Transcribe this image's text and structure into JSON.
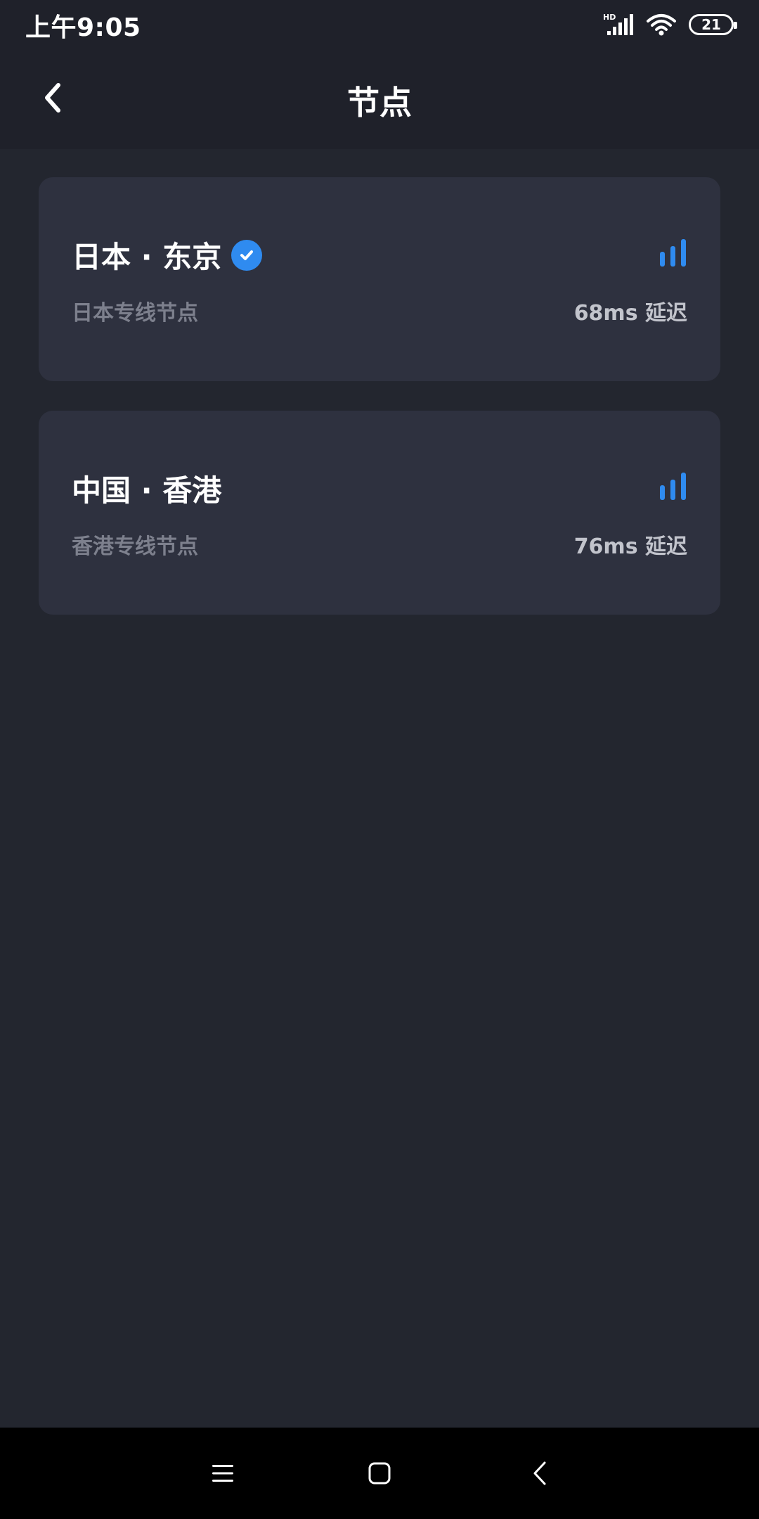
{
  "status_bar": {
    "time": "上午9:05",
    "network_label": "HD",
    "battery_level": "21"
  },
  "header": {
    "title": "节点"
  },
  "nodes": [
    {
      "name": "日本 · 东京",
      "description": "日本专线节点",
      "latency": "68ms 延迟",
      "selected": true
    },
    {
      "name": "中国 · 香港",
      "description": "香港专线节点",
      "latency": "76ms 延迟",
      "selected": false
    }
  ],
  "colors": {
    "background": "#23262f",
    "header_background": "#1f212a",
    "card_background": "#2e313f",
    "accent": "#2f8bf0",
    "muted_text": "#7d808d",
    "latency_text": "#c2c4cc"
  },
  "icons": {
    "back": "chevron-left-icon",
    "selected": "check-circle-icon",
    "signal": "signal-bars-icon",
    "nav_menu": "menu-icon",
    "nav_home": "home-square-icon",
    "nav_back": "back-triangle-icon"
  }
}
